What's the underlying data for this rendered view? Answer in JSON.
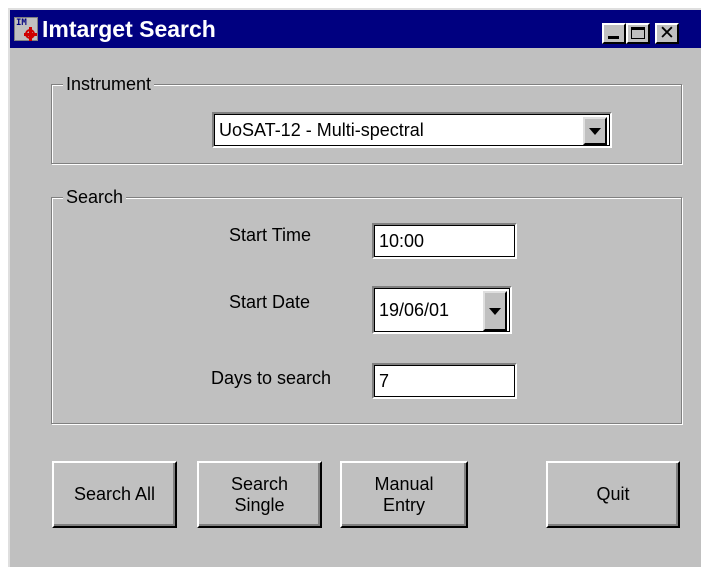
{
  "window": {
    "title": "Imtarget Search"
  },
  "instrument": {
    "group_label": "Instrument",
    "selected": "UoSAT-12 -  Multi-spectral"
  },
  "search": {
    "group_label": "Search",
    "start_time_label": "Start Time",
    "start_time_value": "10:00",
    "start_date_label": "Start Date",
    "start_date_value": "19/06/01",
    "days_label": "Days to search",
    "days_value": "7"
  },
  "buttons": {
    "search_all": "Search All",
    "search_single": "Search\nSingle",
    "manual_entry": "Manual\nEntry",
    "quit": "Quit"
  }
}
